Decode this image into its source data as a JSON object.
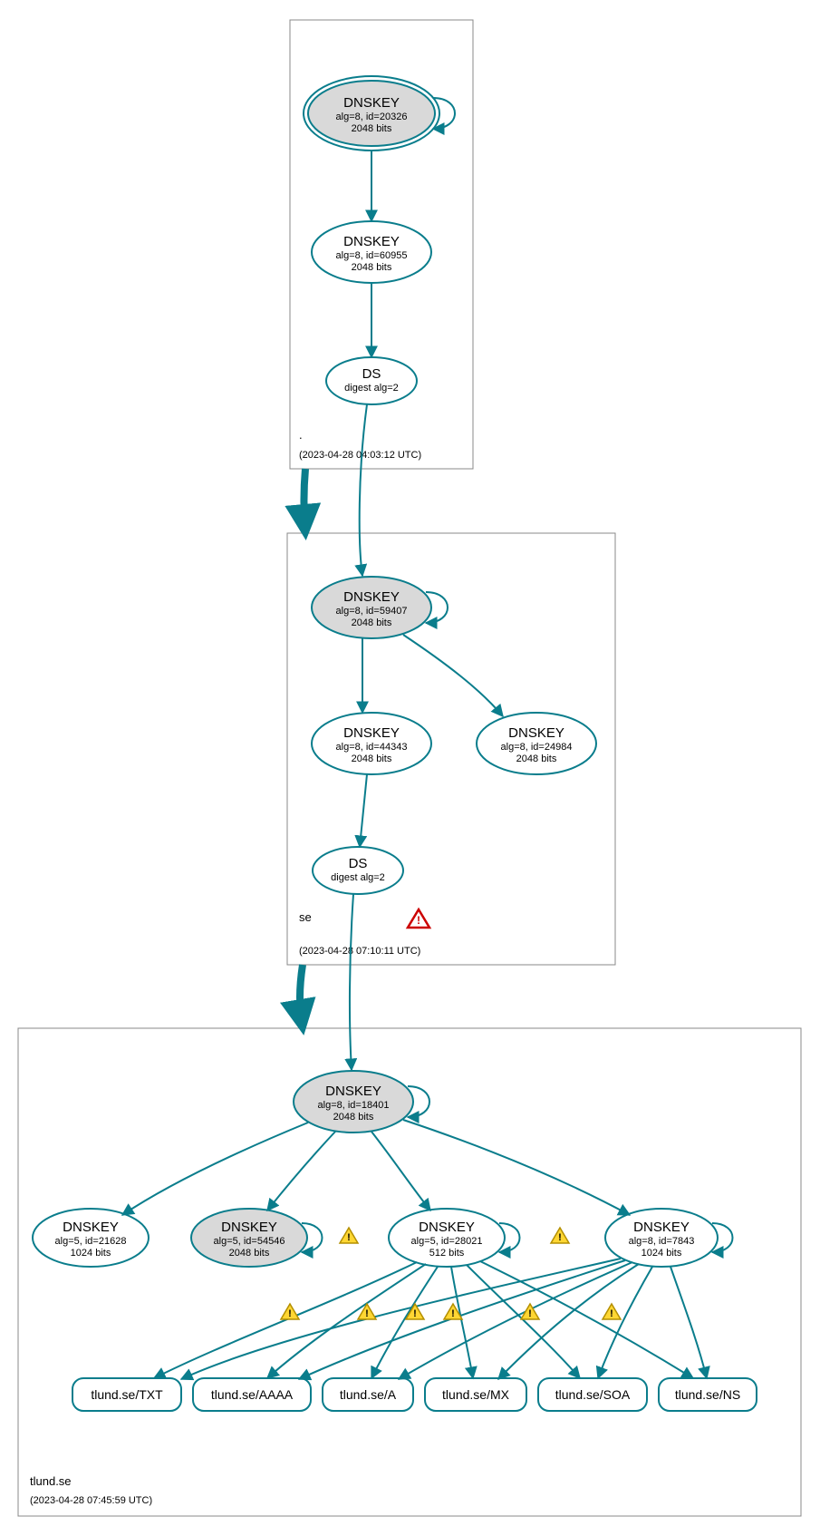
{
  "colors": {
    "stroke": "#0a7d8c",
    "fill_gray": "#d9d9d9",
    "fill_white": "#ffffff",
    "box_stroke": "#888888",
    "text": "#000000",
    "warn_fill": "#ffd633",
    "warn_stroke": "#b38f00",
    "err_stroke": "#cc0000"
  },
  "zones": {
    "root": {
      "name": ".",
      "timestamp": "(2023-04-28 04:03:12 UTC)"
    },
    "se": {
      "name": "se",
      "timestamp": "(2023-04-28 07:10:11 UTC)"
    },
    "tlund": {
      "name": "tlund.se",
      "timestamp": "(2023-04-28 07:45:59 UTC)"
    }
  },
  "nodes": {
    "root_ksk": {
      "title": "DNSKEY",
      "l1": "alg=8, id=20326",
      "l2": "2048 bits"
    },
    "root_zsk": {
      "title": "DNSKEY",
      "l1": "alg=8, id=60955",
      "l2": "2048 bits"
    },
    "root_ds": {
      "title": "DS",
      "l1": "digest alg=2",
      "l2": ""
    },
    "se_ksk": {
      "title": "DNSKEY",
      "l1": "alg=8, id=59407",
      "l2": "2048 bits"
    },
    "se_zsk": {
      "title": "DNSKEY",
      "l1": "alg=8, id=44343",
      "l2": "2048 bits"
    },
    "se_zsk2": {
      "title": "DNSKEY",
      "l1": "alg=8, id=24984",
      "l2": "2048 bits"
    },
    "se_ds": {
      "title": "DS",
      "l1": "digest alg=2",
      "l2": ""
    },
    "tl_ksk": {
      "title": "DNSKEY",
      "l1": "alg=8, id=18401",
      "l2": "2048 bits"
    },
    "tl_k1": {
      "title": "DNSKEY",
      "l1": "alg=5, id=21628",
      "l2": "1024 bits"
    },
    "tl_k2": {
      "title": "DNSKEY",
      "l1": "alg=5, id=54546",
      "l2": "2048 bits"
    },
    "tl_k3": {
      "title": "DNSKEY",
      "l1": "alg=5, id=28021",
      "l2": "512 bits"
    },
    "tl_k4": {
      "title": "DNSKEY",
      "l1": "alg=8, id=7843",
      "l2": "1024 bits"
    }
  },
  "rrsets": {
    "txt": "tlund.se/TXT",
    "aaaa": "tlund.se/AAAA",
    "a": "tlund.se/A",
    "mx": "tlund.se/MX",
    "soa": "tlund.se/SOA",
    "ns": "tlund.se/NS"
  }
}
